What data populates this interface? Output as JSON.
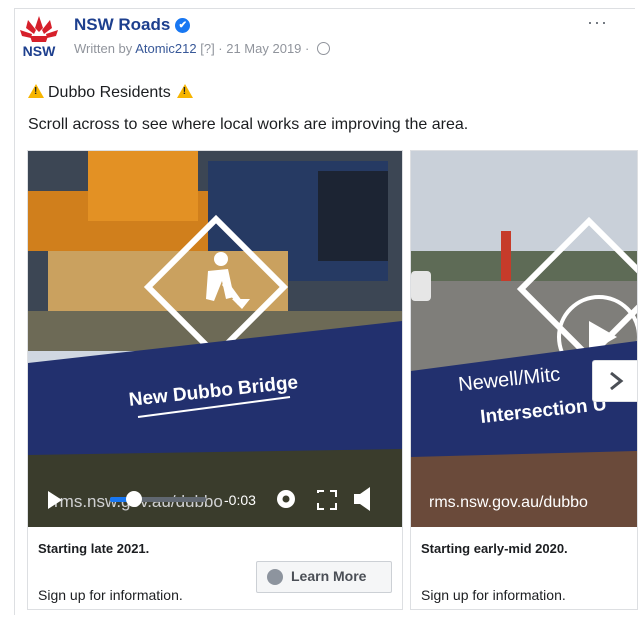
{
  "post": {
    "page_name": "NSW Roads",
    "written_by_prefix": "Written by ",
    "author": "Atomic212",
    "author_suffix": " [?]",
    "date": " · 21 May 2019 · ",
    "more": "···",
    "line1": "Dubbo Residents",
    "line2": "Scroll across to see where local works are improving the area.",
    "logo_text": "NSW"
  },
  "cards": [
    {
      "banner": "New Dubbo Bridge",
      "url_overlay": "rms.nsw.gov.au/dubbo",
      "time": "-0:03",
      "progress": 0.25,
      "caption_title": "Starting late 2021.",
      "caption_sub": "Sign up for information.",
      "cta": "Learn More"
    },
    {
      "banner_line1": "Newell/Mitc",
      "banner_line2": "Intersection U",
      "url_overlay": "rms.nsw.gov.au/dubbo",
      "caption_title": "Starting early-mid 2020.",
      "caption_sub": "Sign up for information."
    }
  ],
  "colors": {
    "brand_blue": "#1d3f8e",
    "banner_blue": "#22306e",
    "accent_blue": "#1877f2"
  }
}
